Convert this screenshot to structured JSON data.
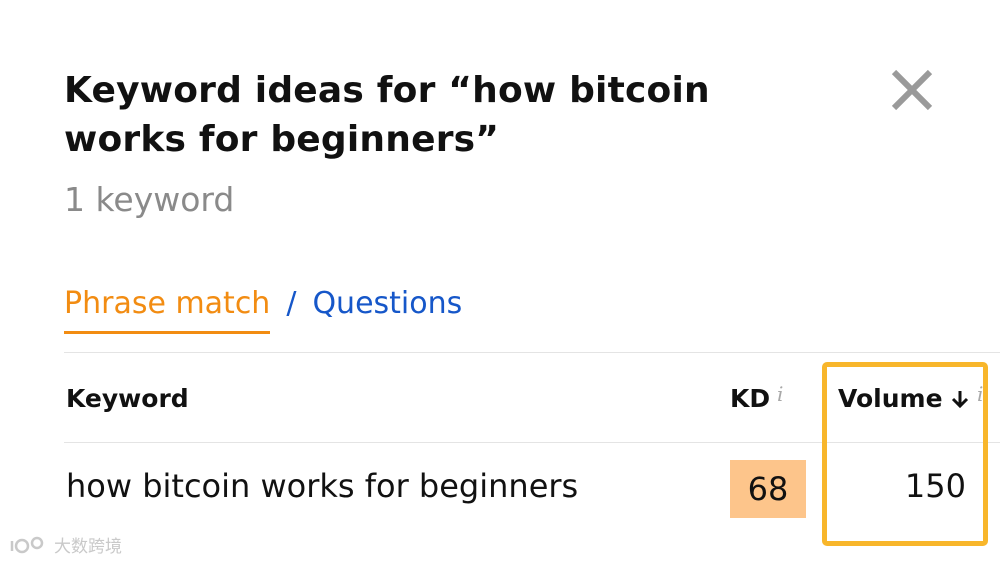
{
  "header": {
    "title": "Keyword ideas for “how bitcoin works for beginners”",
    "subtitle": "1 keyword",
    "close_icon": "close-icon"
  },
  "tabs": {
    "active_label": "Phrase match",
    "separator": "/",
    "other_label": "Questions",
    "active_color": "#f28c12",
    "link_color": "#1657c9"
  },
  "table": {
    "columns": {
      "keyword": "Keyword",
      "kd": "KD",
      "kd_info": "i",
      "volume": "Volume",
      "volume_info": "i",
      "volume_sort_icon": "arrow-down-icon"
    },
    "rows": [
      {
        "keyword": "how bitcoin works for beginners",
        "kd": "68",
        "volume": "150",
        "kd_color": "#fdc58b"
      }
    ]
  },
  "annotation": {
    "highlight_color": "#f8b62b",
    "target": "Volume column"
  },
  "watermark": {
    "text": "大数跨境"
  }
}
